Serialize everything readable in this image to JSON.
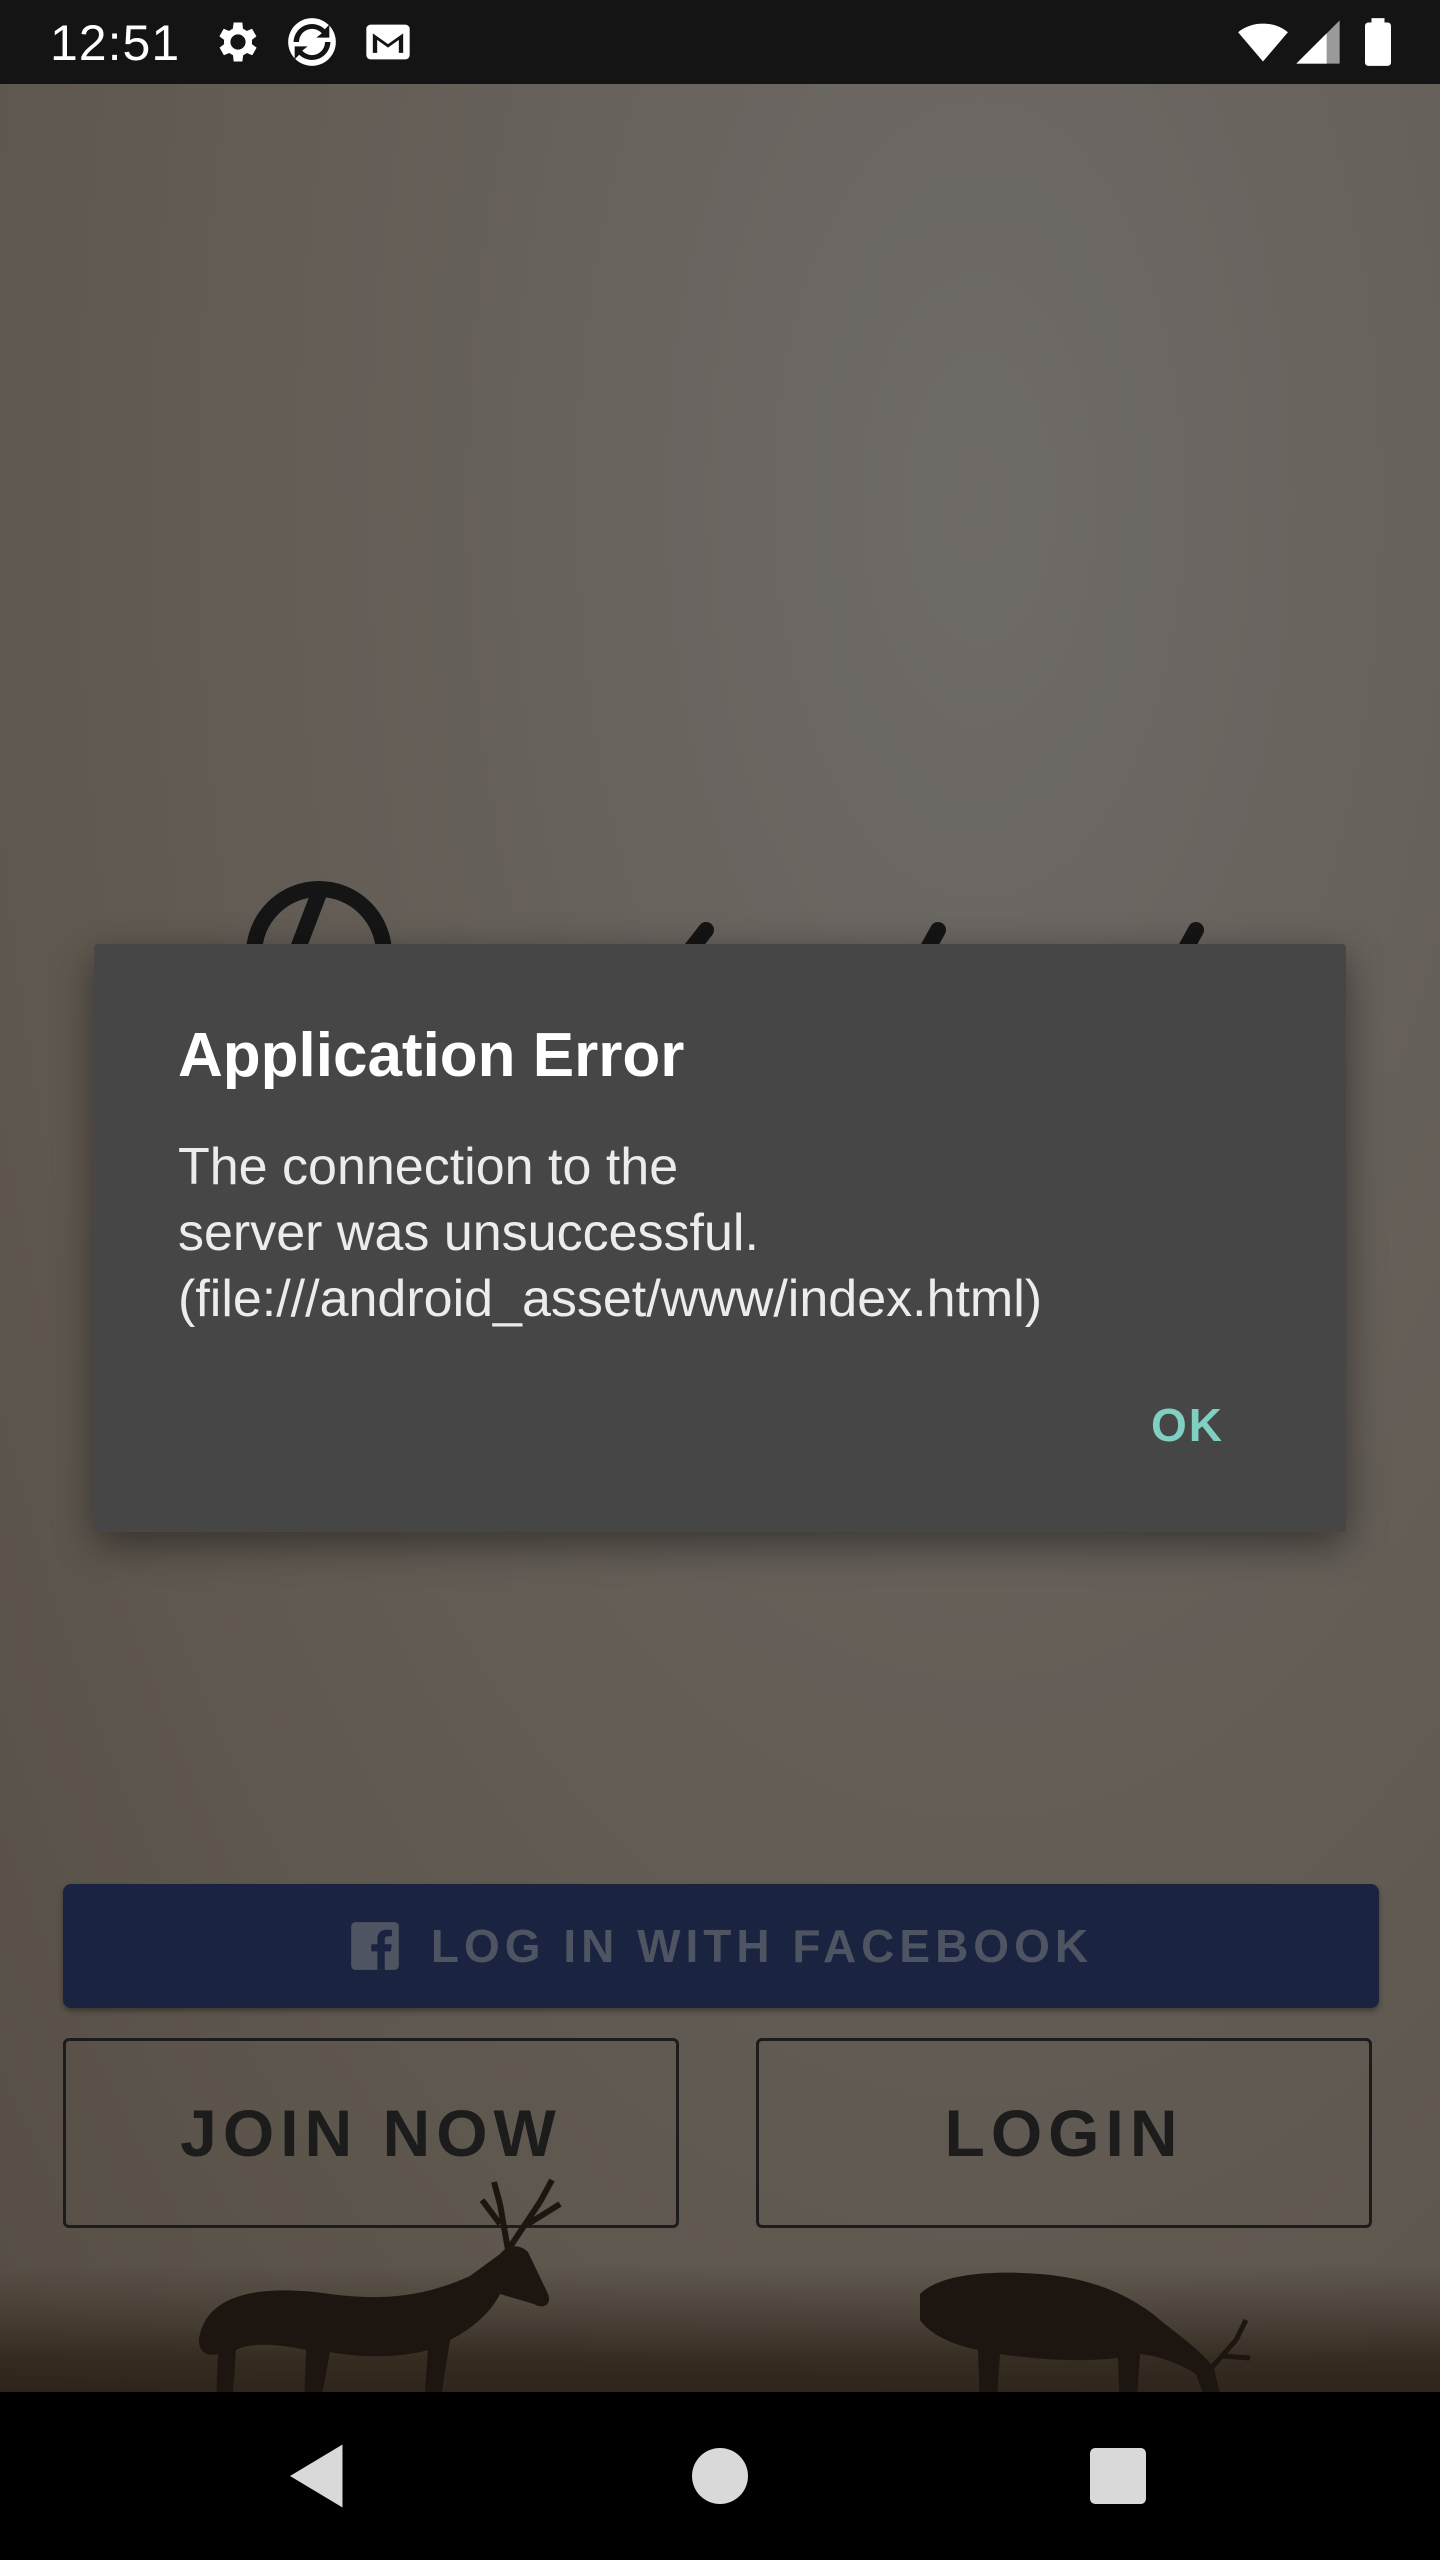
{
  "status_bar": {
    "time": "12:51",
    "left_icons": [
      "settings-icon",
      "sync-icon",
      "gmail-icon"
    ],
    "right_icons": [
      "wifi-icon",
      "cellular-signal-icon",
      "battery-icon"
    ]
  },
  "app": {
    "facebook_button_label": "LOG IN WITH FACEBOOK",
    "join_button_label": "JOIN NOW",
    "login_button_label": "LOGIN"
  },
  "dialog": {
    "title": "Application Error",
    "message": "The connection to the\nserver was unsuccessful.\n(file:///android_asset/www/index.html)",
    "ok_label": "OK"
  },
  "colors": {
    "dialog_background": "#464646",
    "dialog_action": "#7fcfc2",
    "facebook_button": "#1a2340",
    "status_bar": "#141414",
    "navigation_bar": "#000000"
  },
  "nav_bar": {
    "buttons": [
      "back-icon",
      "home-icon",
      "recents-icon"
    ]
  }
}
